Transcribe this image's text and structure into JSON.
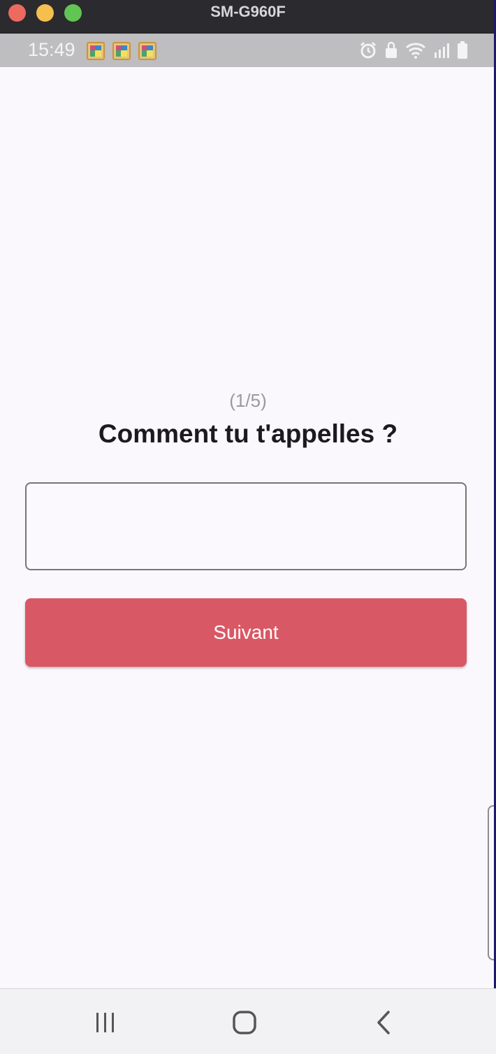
{
  "window": {
    "title": "SM-G960F"
  },
  "status_bar": {
    "time": "15:49",
    "notification_icons": [
      "app-icon",
      "app-icon",
      "app-icon"
    ],
    "system_icons": [
      "alarm-icon",
      "lock-icon",
      "wifi-icon",
      "signal-icon",
      "battery-icon"
    ]
  },
  "form": {
    "step": "(1/5)",
    "question": "Comment tu t'appelles ?",
    "name_value": "",
    "name_placeholder": "",
    "next_label": "Suivant"
  },
  "nav_bar": {
    "buttons": [
      "recents-icon",
      "home-icon",
      "back-icon"
    ]
  },
  "colors": {
    "accent": "#d95865",
    "background": "#faf8fc",
    "status_bar": "#bebdbf"
  }
}
